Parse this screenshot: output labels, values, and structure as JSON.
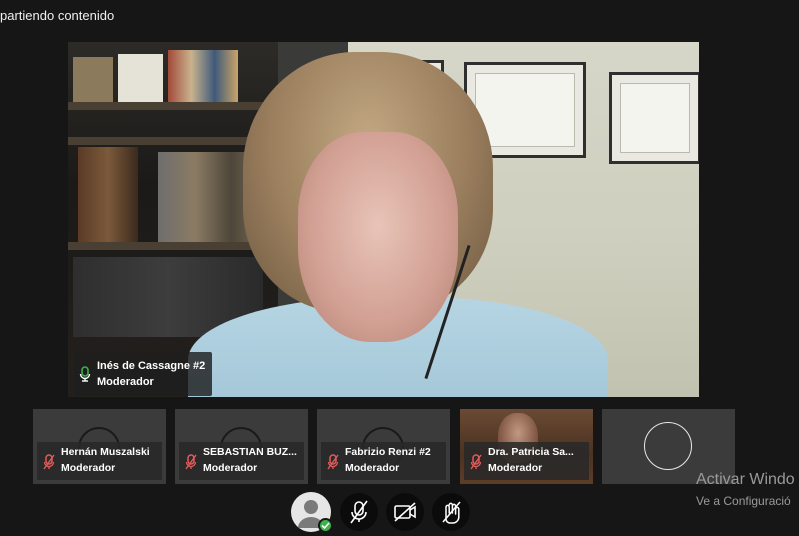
{
  "header": {
    "status_text": "partiendo contenido"
  },
  "main_video": {
    "participant_name": "Inés de Cassagne #2",
    "role": "Moderador"
  },
  "participants": [
    {
      "name": "Hernán Muszalski",
      "role": "Moderador",
      "type": "avatar"
    },
    {
      "name": "SEBASTIAN BUZ...",
      "role": "Moderador",
      "type": "avatar"
    },
    {
      "name": "Fabrizio Renzi #2",
      "role": "Moderador",
      "type": "avatar"
    },
    {
      "name": "Dra. Patricia Sa...",
      "role": "Moderador",
      "type": "video"
    }
  ],
  "watermark": {
    "title": "Activar Windo",
    "subtitle": "Ve a Configuració"
  },
  "colors": {
    "background": "#161616",
    "tile": "#3b3b3b",
    "mic_muted": "#e25c5c",
    "mic_active": "#3bb34a",
    "control_bg": "#0b0b0b"
  },
  "icons": {
    "user": "user-avatar-icon",
    "mic": "mic-off-icon",
    "camera": "camera-off-icon",
    "hand": "raise-hand-icon"
  }
}
